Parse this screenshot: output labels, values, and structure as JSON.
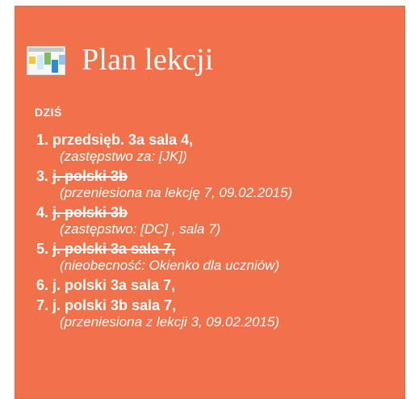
{
  "colors": {
    "card_background": "#f0714a",
    "text": "#ffffff"
  },
  "widget": {
    "icon": "timetable-app-icon",
    "title": "Plan lekcji",
    "section_label": "DZIŚ"
  },
  "lessons": [
    {
      "number": "1.",
      "subject": "przedsięb. 3a sala 4,",
      "note": "(zastępstwo za: [JK])",
      "strikethrough": false
    },
    {
      "number": "3.",
      "subject": "j. polski 3b",
      "note": "(przeniesiona na lekcję 7, 09.02.2015)",
      "strikethrough": true
    },
    {
      "number": "4.",
      "subject": "j. polski 3b",
      "note": "(zastępstwo: [DC] , sala  7)",
      "strikethrough": true
    },
    {
      "number": "5.",
      "subject": "j. polski 3a sala 7,",
      "note": "(nieobecność: Okienko dla uczniów)",
      "strikethrough": true
    },
    {
      "number": "6.",
      "subject": "j. polski 3a sala 7,",
      "note": "",
      "strikethrough": false
    },
    {
      "number": "7.",
      "subject": "j. polski 3b sala 7,",
      "note": "(przeniesiona z lekcji 3, 09.02.2015)",
      "strikethrough": false
    }
  ]
}
